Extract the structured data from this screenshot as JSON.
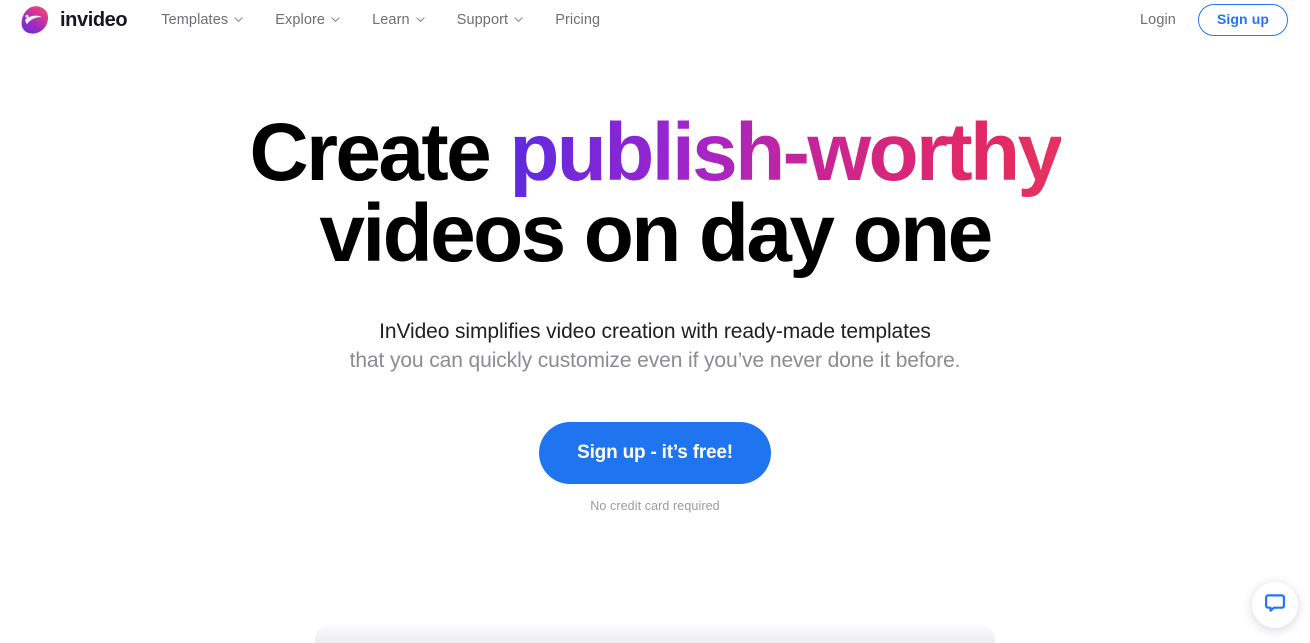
{
  "brand": {
    "name": "invideo",
    "logo_icon": "invideo-blob-logo",
    "gradient_start": "#e0408f",
    "gradient_end": "#6b2bd9"
  },
  "header": {
    "nav": [
      {
        "label": "Templates",
        "has_dropdown": true,
        "icon": "chevron-down-icon"
      },
      {
        "label": "Explore",
        "has_dropdown": true,
        "icon": "chevron-down-icon"
      },
      {
        "label": "Learn",
        "has_dropdown": true,
        "icon": "chevron-down-icon"
      },
      {
        "label": "Support",
        "has_dropdown": true,
        "icon": "chevron-down-icon"
      },
      {
        "label": "Pricing",
        "has_dropdown": false,
        "icon": ""
      }
    ],
    "login_label": "Login",
    "signup_label": "Sign up",
    "accent_color": "#2176f5"
  },
  "hero": {
    "headline_part_1": "Create ",
    "headline_highlight": "publish-worthy",
    "headline_line_2": "videos on day one",
    "highlight_gradient_start": "#5b2be0",
    "highlight_gradient_end": "#e63462",
    "subtitle_line_1": "InVideo simplifies video creation with ready-made templates",
    "subtitle_line_2": "that you can quickly customize even if you’ve never done it before.",
    "cta_label": "Sign up - it’s free!",
    "cta_color": "#1f74f0",
    "cta_note": "No credit card required"
  },
  "chat": {
    "icon": "chat-bubble-icon",
    "color": "#2176f5"
  }
}
